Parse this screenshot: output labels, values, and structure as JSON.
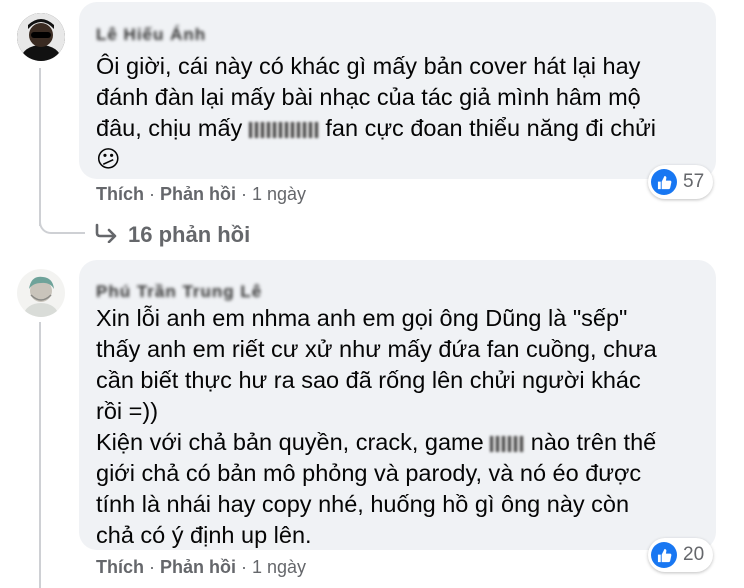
{
  "comments": [
    {
      "author": "Lê Hiếu Ánh",
      "text_lines": [
        "Ôi giời, cái này có khác gì mấy bản cover hát lại hay",
        "đánh đàn lại mấy bài nhạc của tác giả mình hâm mộ",
        "đâu, chịu mấy",
        "fan cực đoan thiểu năng đi chửi"
      ],
      "emoji": "😕",
      "likes": "57",
      "actions": {
        "like": "Thích",
        "reply": "Phản hồi",
        "time": "1 ngày"
      },
      "replies": "16 phản hồi"
    },
    {
      "author": "Phú Trần Trung Lê",
      "text_lines": [
        "Xin lỗi anh em nhma anh em gọi ông Dũng là \"sếp\"",
        "thấy anh em riết cư xử như mấy đứa fan cuồng, chưa",
        "cần biết thực hư ra sao đã rống lên chửi người khác",
        "rồi =))",
        "Kiện với chả bản quyền, crack, game",
        "nào trên thế",
        "giới chả có bản mô phỏng và parody, và nó éo được",
        "tính là nhái hay copy nhé, huống hồ gì ông này còn",
        "chả có ý định up lên."
      ],
      "likes": "20",
      "actions": {
        "like": "Thích",
        "reply": "Phản hồi",
        "time": "1 ngày"
      }
    }
  ],
  "colors": {
    "bubble": "#f0f2f5",
    "meta": "#65676b",
    "like": "#1877f2"
  },
  "icons": {
    "like": "thumbs-up-icon",
    "reply_arrow": "reply-arrow-icon"
  }
}
